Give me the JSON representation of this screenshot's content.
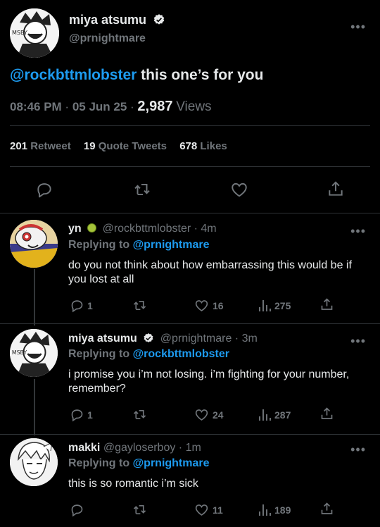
{
  "main_tweet": {
    "display_name": "miya atsumu",
    "handle": "@prnightmare",
    "mention": "@rockbttmlobster",
    "text": " this one’s for you",
    "time": "08:46 PM",
    "date": "05 Jun 25",
    "views_count": "2,987",
    "views_label": "Views",
    "retweets_count": "201",
    "retweets_label": "Retweet",
    "quotes_count": "19",
    "quotes_label": "Quote Tweets",
    "likes_count": "678",
    "likes_label": "Likes"
  },
  "replies": [
    {
      "display_name": "yn",
      "handle": "@rockbttmlobster",
      "time": "4m",
      "replying_prefix": "Replying to",
      "replying_to": "@prnightmare",
      "text": "do you not think about how embarrassing this would be if you lost at all",
      "reply_count": "1",
      "like_count": "16",
      "view_count": "275"
    },
    {
      "display_name": "miya atsumu",
      "handle": "@prnightmare",
      "time": "3m",
      "replying_prefix": "Replying to",
      "replying_to": "@rockbttmlobster",
      "text": "i promise you i’m not losing. i’m fighting for your number, remember?",
      "reply_count": "1",
      "like_count": "24",
      "view_count": "287"
    },
    {
      "display_name": "makki",
      "handle": "@gayloserboy",
      "time": "1m",
      "replying_prefix": "Replying to",
      "replying_to": "@prnightmare",
      "text": "this is so romantic i’m sick",
      "reply_count": "",
      "like_count": "11",
      "view_count": "189"
    }
  ],
  "avatar_texts": {
    "msby_1": "MSBY",
    "msby_2": "MSBY"
  },
  "sep": " · ",
  "more_glyph": "•••",
  "colors": {
    "accent": "#1d9bf0",
    "muted": "#71767b",
    "bg": "#000000"
  }
}
